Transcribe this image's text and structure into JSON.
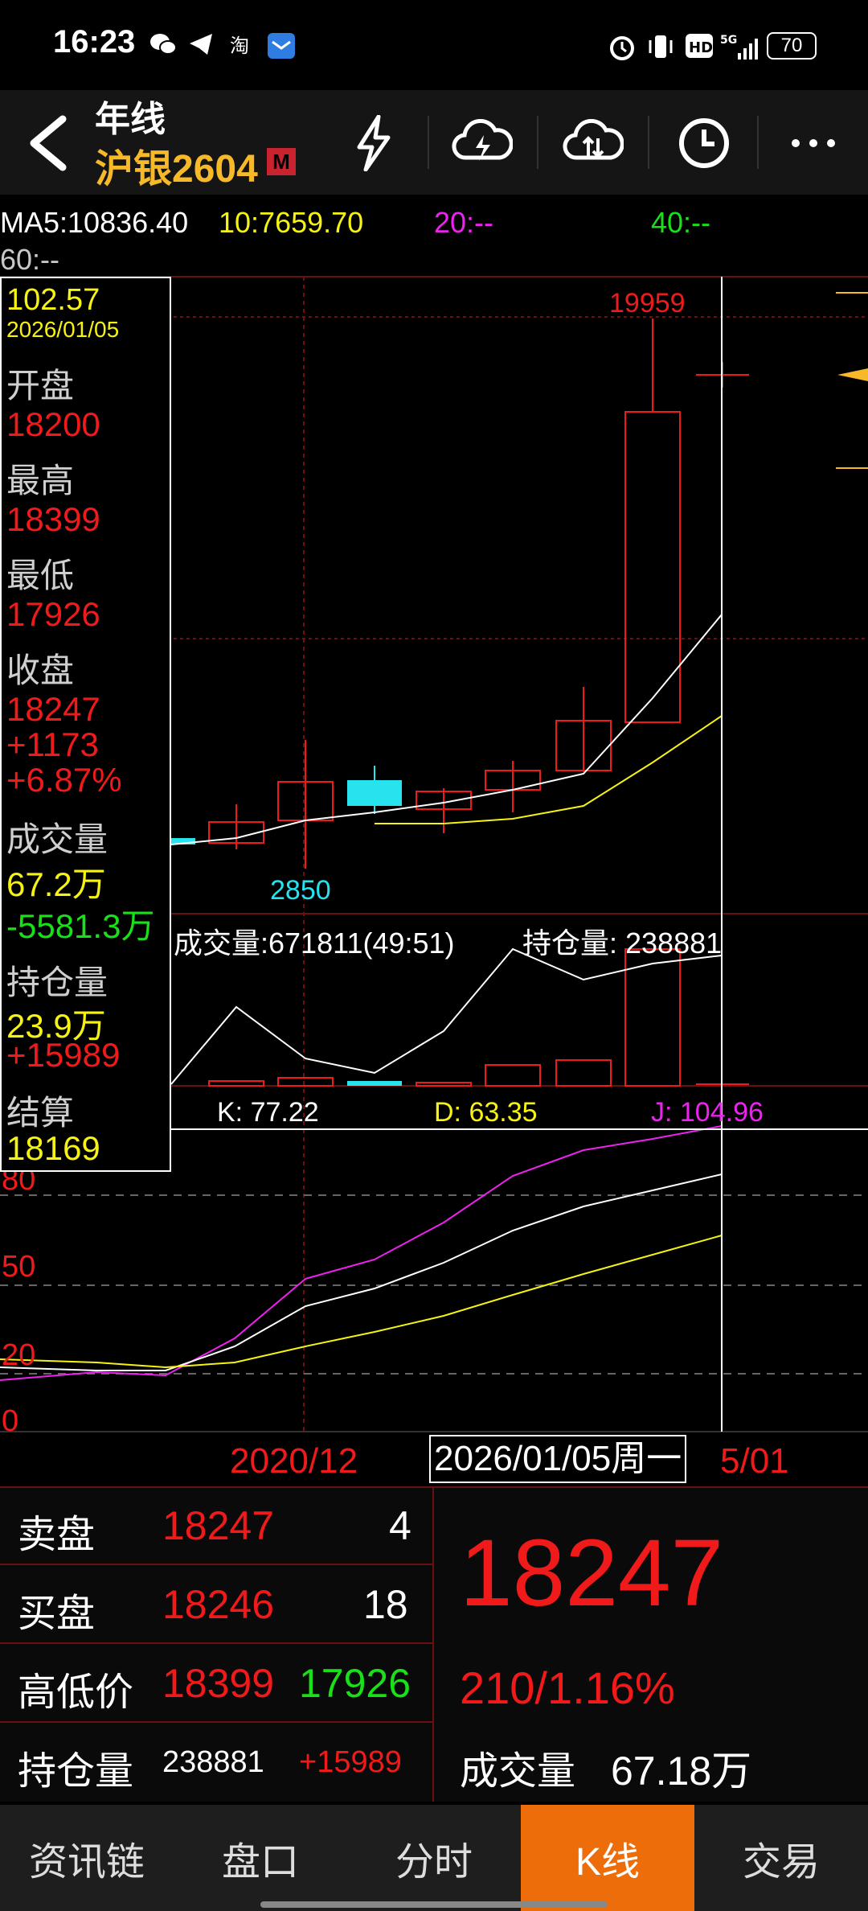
{
  "status_bar": {
    "time": "16:23",
    "app_icons": [
      "wechat-icon",
      "telegram-icon",
      "taobao-icon",
      "mail-icon"
    ],
    "right_icons": [
      "alarm-icon",
      "vibrate-icon",
      "hd-icon",
      "signal-5g-icon"
    ],
    "battery": "70"
  },
  "header": {
    "period": "年线",
    "symbol": "沪银2604",
    "badge": "M"
  },
  "ma": {
    "ma5": "MA5:10836.40",
    "ma10": "10:7659.70",
    "ma20": "20:--",
    "ma40": "40:--",
    "ma60": "60:--"
  },
  "info_panel": {
    "price": "102.57",
    "date": "2026/01/05",
    "open_label": "开盘",
    "open": "18200",
    "high_label": "最高",
    "high": "18399",
    "low_label": "最低",
    "low": "17926",
    "close_label": "收盘",
    "close": "18247",
    "change": "+1173",
    "change_pct": "+6.87%",
    "volume_label": "成交量",
    "volume": "67.2万",
    "volume_change": "-5581.3万",
    "oi_label": "持仓量",
    "oi": "23.9万",
    "oi_change": "+15989",
    "settle_label": "结算",
    "settle": "18169"
  },
  "chart_labels": {
    "peak": "19959",
    "low_mark": "2850",
    "vol_text": "成交量:671811(49:51)",
    "oi_text": "持仓量: 238881",
    "k": "K: 77.22",
    "d": "D: 63.35",
    "j": "J: 104.96",
    "kdj_ticks": [
      "80",
      "50",
      "20",
      "0"
    ],
    "date_left": "2020/12",
    "date_cursor": "2026/01/05周一",
    "date_right": "5/01"
  },
  "quote": {
    "sell_label": "卖盘",
    "sell_price": "18247",
    "sell_qty": "4",
    "buy_label": "买盘",
    "buy_price": "18246",
    "buy_qty": "18",
    "hl_label": "高低价",
    "hl_high": "18399",
    "hl_low": "17926",
    "oi_label": "持仓量",
    "oi_value": "238881",
    "oi_change": "+15989",
    "last": "18247",
    "change": "210/1.16%",
    "volume_label": "成交量",
    "volume": "67.18万"
  },
  "tabs": [
    {
      "label": "资讯链"
    },
    {
      "label": "盘口"
    },
    {
      "label": "分时"
    },
    {
      "label": "K线"
    },
    {
      "label": "交易"
    }
  ],
  "colors": {
    "up": "#f01a1a",
    "down": "#26e3ee",
    "ma5": "#ffffff",
    "ma10": "#f5f214",
    "k": "#ffffff",
    "d": "#f5f214",
    "j": "#ee22ee",
    "active_tab": "#ee6d0b"
  }
}
